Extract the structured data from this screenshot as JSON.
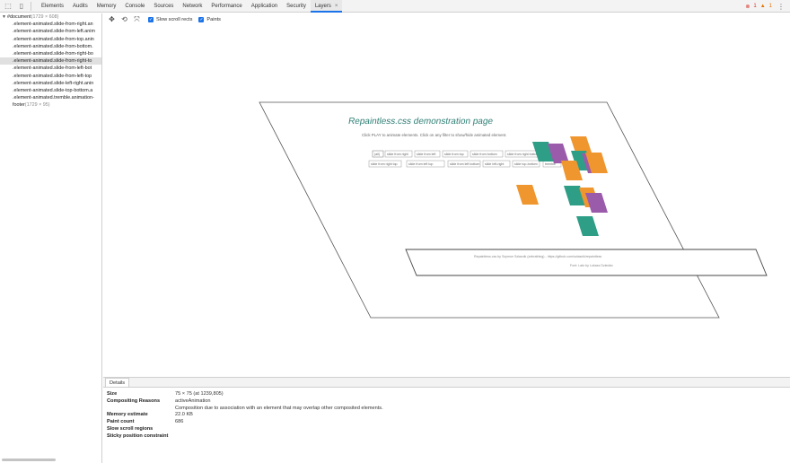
{
  "topbar": {
    "tabs": [
      {
        "label": "Elements"
      },
      {
        "label": "Audits"
      },
      {
        "label": "Memory"
      },
      {
        "label": "Console"
      },
      {
        "label": "Sources"
      },
      {
        "label": "Network"
      },
      {
        "label": "Performance"
      },
      {
        "label": "Application"
      },
      {
        "label": "Security"
      },
      {
        "label": "Layers",
        "active": true,
        "close": "×"
      }
    ],
    "error_count": "1",
    "warning_count": "1"
  },
  "tree": {
    "root_label": "#document",
    "root_dims": "(1729 × 608)",
    "rows": [
      ".element-animated.slide-from-right.an",
      ".element-animated.slide-from-left.anim",
      ".element-animated.slide-from-top.anin",
      ".element-animated.slide-from-bottom.",
      ".element-animated.slide-from-right-bo",
      ".element-animated.slide-from-right-to",
      ".element-animated.slide-from-left-bot",
      ".element-animated.slide-from-left-top",
      ".element-animated.slide-left-right.anin",
      ".element-animated.slide-top-bottom.a",
      ".element-animated.tremble.animation-",
      "footer"
    ],
    "selected_index": 5,
    "footer_dims": "(1729 × 95)"
  },
  "layers_toolbar": {
    "slow_scroll_rects_label": "Slow scroll rects",
    "paints_label": "Paints"
  },
  "canvas": {
    "page_title": "Repaintless.css demonstration page",
    "page_subtitle": "Click PLAY to animate elements. Click on any filter to show/hide animated element.",
    "filter_buttons": [
      "(all)",
      "slide from right",
      "slide from left",
      "slide from top",
      "slide from bottom",
      "slide from right bottom",
      "slide from right top",
      "slide from left top",
      "slide from left bottom",
      "slide left-right",
      "slide top-bottom",
      "tremble"
    ],
    "footer_text_1": "Repaintless.css by Szymon Szlasnik (zebrathing) - https://github.com/szlasnik/repaintless",
    "footer_text_2": "Font: Lato by Lukasz Dziedzic",
    "colors": {
      "teal": "#2e9e87",
      "orange": "#f0962e",
      "purple": "#9a5bab"
    }
  },
  "details": {
    "tab_label": "Details",
    "rows": [
      {
        "key": "Size",
        "value": "75 × 75 (at 1239,805)"
      },
      {
        "key": "Compositing Reasons",
        "value": "activeAnimation"
      },
      {
        "key": "",
        "value": "Composition due to association with an element that may overlap other composited elements."
      },
      {
        "key": "Memory estimate",
        "value": "22.0 KB"
      },
      {
        "key": "Paint count",
        "value": "686"
      },
      {
        "key": "Slow scroll regions",
        "value": ""
      },
      {
        "key": "Sticky position constraint",
        "value": ""
      }
    ]
  }
}
